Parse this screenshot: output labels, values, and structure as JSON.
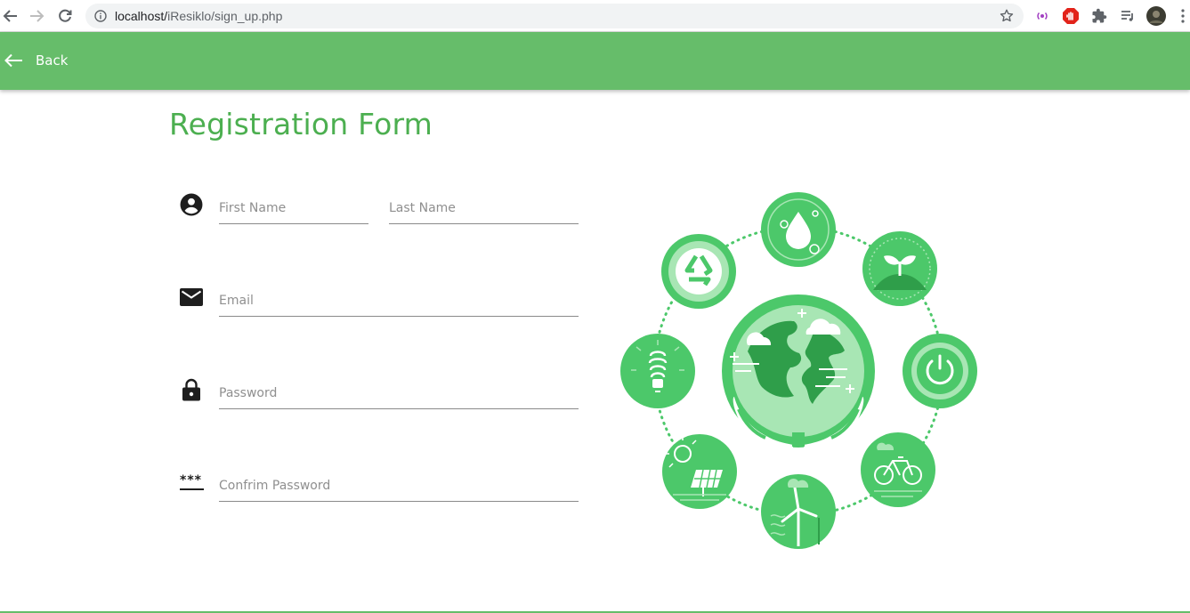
{
  "browser": {
    "url_host": "localhost/",
    "url_path": "iResiklo/sign_up.php"
  },
  "header": {
    "back_label": "Back"
  },
  "form": {
    "title": "Registration Form",
    "first_name_placeholder": "First Name",
    "last_name_placeholder": "Last Name",
    "email_placeholder": "Email",
    "password_placeholder": "Password",
    "confirm_password_placeholder": "Confrim Password",
    "confirm_icon_text": "***"
  },
  "icons": {
    "person": "account-circle-icon",
    "email": "mail-icon",
    "password": "lock-icon",
    "confirm": "password-dots-icon"
  },
  "colors": {
    "brand_green": "#66bd6a",
    "title_green": "#4caf50",
    "illustration_green": "#4cc86a"
  }
}
